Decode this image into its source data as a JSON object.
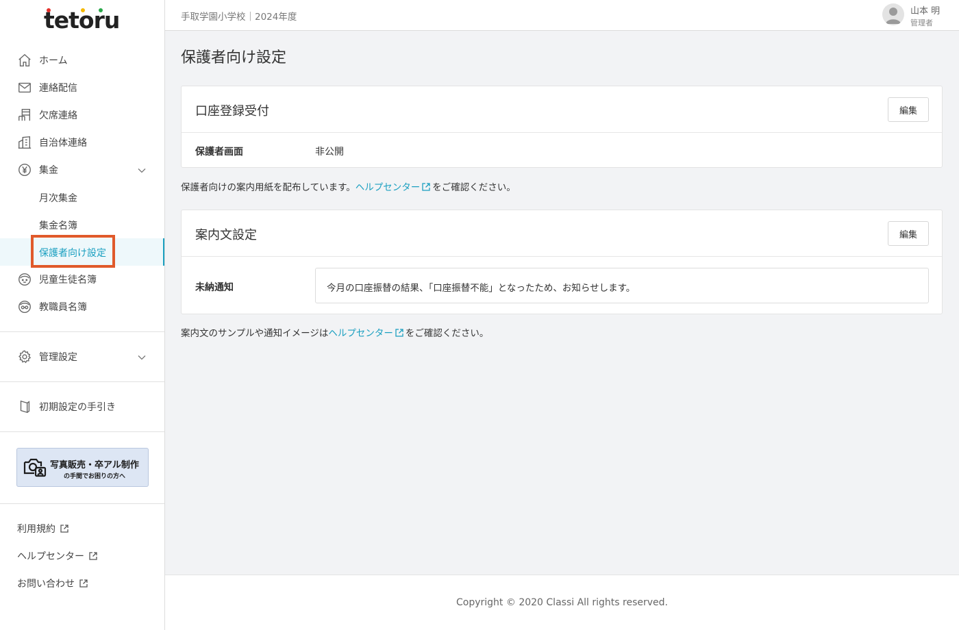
{
  "app": {
    "logo_text": "tetoru",
    "logo_dot_colors": [
      "#e5312c",
      "#f5b800",
      "#2aa84a"
    ]
  },
  "sidebar": {
    "items": [
      {
        "label": "ホーム",
        "icon": "home-icon"
      },
      {
        "label": "連絡配信",
        "icon": "mail-icon"
      },
      {
        "label": "欠席連絡",
        "icon": "chair-icon"
      },
      {
        "label": "自治体連絡",
        "icon": "building-icon"
      },
      {
        "label": "集金",
        "icon": "yen-icon"
      },
      {
        "label": "児童生徒名簿",
        "icon": "student-icon"
      },
      {
        "label": "教職員名簿",
        "icon": "teacher-icon"
      }
    ],
    "subitems": [
      {
        "label": "月次集金"
      },
      {
        "label": "集金名簿"
      },
      {
        "label": "保護者向け設定"
      }
    ],
    "admin": {
      "label": "管理設定",
      "icon": "gear-icon"
    },
    "guide": {
      "label": "初期設定の手引き",
      "icon": "book-icon"
    },
    "banner": {
      "title": "写真販売・卒アル制作",
      "subtitle": "の手間でお困りの方へ"
    },
    "links": [
      {
        "label": "利用規約"
      },
      {
        "label": "ヘルプセンター"
      },
      {
        "label": "お問い合わせ"
      }
    ],
    "accent_color": "#1a9fc0",
    "highlight_color": "#e05a2b"
  },
  "header": {
    "school": "手取学園小学校｜2024年度",
    "user_name": "山本 明",
    "user_role": "管理者"
  },
  "main": {
    "title": "保護者向け設定",
    "account_card": {
      "title": "口座登録受付",
      "edit_label": "編集",
      "row_label": "保護者画面",
      "row_value": "非公開"
    },
    "note1": {
      "before": "保護者向けの案内用紙を配布しています。",
      "link": "ヘルプセンター",
      "after": "をご確認ください。"
    },
    "message_card": {
      "title": "案内文設定",
      "edit_label": "編集",
      "row_label": "未納通知",
      "row_value": "今月の口座振替の結果、「口座振替不能」となったため、お知らせします。"
    },
    "note2": {
      "before": "案内文のサンプルや通知イメージは",
      "link": "ヘルプセンター",
      "after": "をご確認ください。"
    }
  },
  "footer": {
    "copyright": "Copyright © 2020 Classi All rights reserved."
  }
}
